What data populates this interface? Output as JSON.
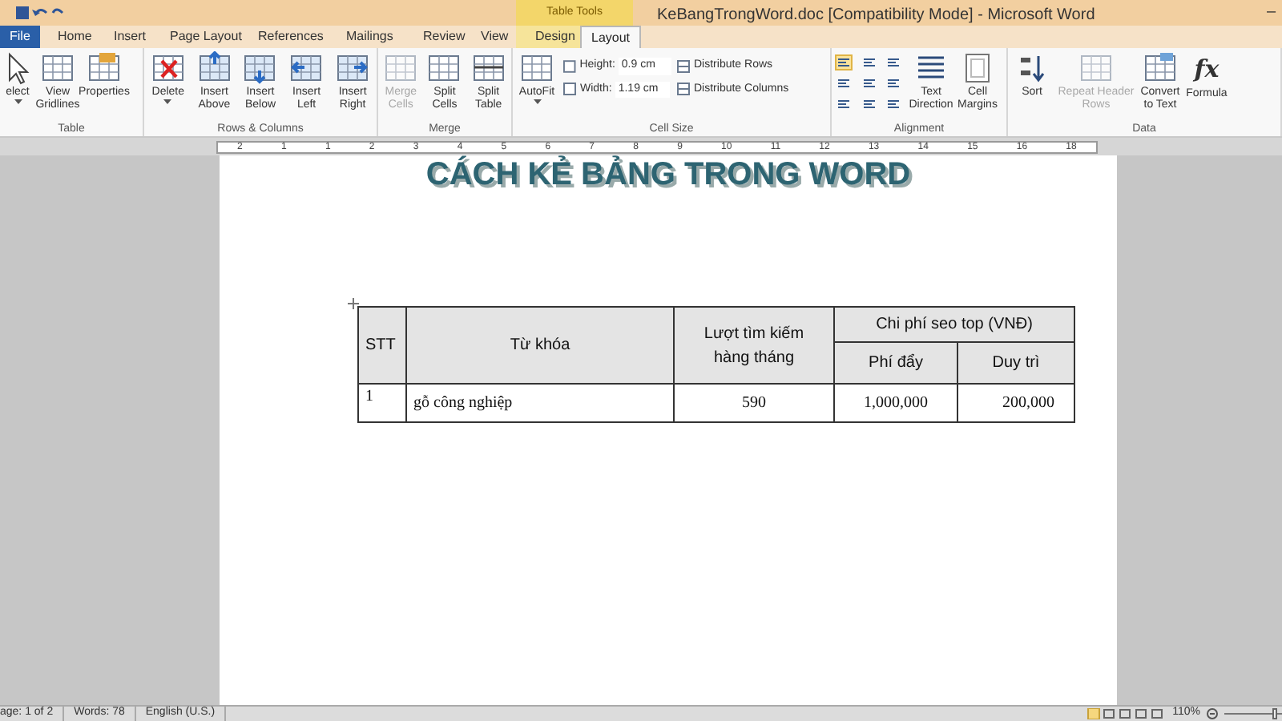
{
  "title_bar": {
    "title": "KeBangTrongWord.doc [Compatibility Mode] - Microsoft Word",
    "contextual_label": "Table Tools",
    "minimize": "–"
  },
  "tabs": [
    {
      "label": "File",
      "kind": "file",
      "selected": false
    },
    {
      "label": "Home",
      "kind": "normal",
      "selected": false
    },
    {
      "label": "Insert",
      "kind": "normal",
      "selected": false
    },
    {
      "label": "Page Layout",
      "kind": "normal",
      "selected": false
    },
    {
      "label": "References",
      "kind": "normal",
      "selected": false
    },
    {
      "label": "Mailings",
      "kind": "normal",
      "selected": false
    },
    {
      "label": "Review",
      "kind": "normal",
      "selected": false
    },
    {
      "label": "View",
      "kind": "normal",
      "selected": false
    },
    {
      "label": "Design",
      "kind": "contextual",
      "selected": false
    },
    {
      "label": "Layout",
      "kind": "contextual",
      "selected": true
    }
  ],
  "ribbon": {
    "groups": [
      {
        "label": "Table",
        "items": [
          {
            "kind": "cursor",
            "label": "elect",
            "disabled": false,
            "dropdown": true
          },
          {
            "kind": "grid",
            "label": "View Gridlines",
            "disabled": false,
            "dropdown": false
          },
          {
            "kind": "properties",
            "label": "Properties",
            "disabled": false,
            "dropdown": false
          }
        ]
      },
      {
        "label": "Rows & Columns",
        "items": [
          {
            "kind": "delete",
            "label": "Delete",
            "disabled": false,
            "dropdown": true
          },
          {
            "kind": "insert_above",
            "label": "Insert Above",
            "disabled": false,
            "dropdown": false
          },
          {
            "kind": "insert_below",
            "label": "Insert Below",
            "disabled": false,
            "dropdown": false
          },
          {
            "kind": "insert_left",
            "label": "Insert Left",
            "disabled": false,
            "dropdown": false
          },
          {
            "kind": "insert_right",
            "label": "Insert Right",
            "disabled": false,
            "dropdown": false
          }
        ]
      },
      {
        "label": "Merge",
        "items": [
          {
            "kind": "merge",
            "label": "Merge Cells",
            "disabled": true,
            "dropdown": false
          },
          {
            "kind": "split",
            "label": "Split Cells",
            "disabled": false,
            "dropdown": false
          },
          {
            "kind": "split_table",
            "label": "Split Table",
            "disabled": false,
            "dropdown": false
          }
        ]
      },
      {
        "label": "Cell Size",
        "items": [
          {
            "kind": "autofit",
            "label": "AutoFit",
            "disabled": false,
            "dropdown": true
          },
          {
            "kind": "spinners",
            "fields": [
              {
                "label": "Height:",
                "value": "0.9 cm"
              },
              {
                "label": "Width:",
                "value": "1.19 cm"
              }
            ]
          },
          {
            "kind": "small_buttons",
            "buttons": [
              "Distribute Rows",
              "Distribute Columns"
            ]
          }
        ]
      },
      {
        "label": "Alignment",
        "items": [
          {
            "kind": "align_grid",
            "cells": [
              {
                "selected": true
              },
              {
                "selected": false
              },
              {
                "selected": false
              },
              {
                "selected": false
              },
              {
                "selected": false
              },
              {
                "selected": false
              },
              {
                "selected": false
              },
              {
                "selected": false
              },
              {
                "selected": false
              }
            ]
          },
          {
            "kind": "text_direction",
            "label": "Text Direction",
            "disabled": false,
            "dropdown": false
          },
          {
            "kind": "margins",
            "label": "Cell Margins",
            "disabled": false,
            "dropdown": false
          }
        ]
      },
      {
        "label": "Data",
        "items": [
          {
            "kind": "sort",
            "label": "Sort",
            "disabled": false,
            "dropdown": false
          },
          {
            "kind": "repeat",
            "label": "Repeat Header Rows",
            "disabled": true,
            "dropdown": false
          },
          {
            "kind": "convert",
            "label": "Convert to Text",
            "disabled": false,
            "dropdown": false
          },
          {
            "kind": "formula",
            "label": "Formula",
            "glyph": "fx",
            "disabled": false,
            "dropdown": false
          }
        ]
      }
    ]
  },
  "ruler": {
    "labels": [
      "2",
      "1",
      "1",
      "2",
      "3",
      "4",
      "5",
      "6",
      "7",
      "8",
      "9",
      "10",
      "11",
      "12",
      "13",
      "14",
      "15",
      "16",
      "18"
    ]
  },
  "document": {
    "heading": "CÁCH KẺ BẢNG TRONG WORD",
    "table": {
      "columns": [
        "STT",
        "Từ khóa",
        "Lượt tìm kiếm hàng tháng"
      ],
      "group_header": "Chi phí seo top (VNĐ)",
      "sub_columns": [
        "Phí đẩy",
        "Duy trì"
      ],
      "rows": [
        [
          "1",
          "gỗ công nghiệp",
          "590",
          "1,000,000",
          "200,000"
        ]
      ]
    }
  },
  "status_bar": {
    "page": "age: 1 of 2",
    "words": "Words: 78",
    "language": "English (U.S.)",
    "zoom": "110%",
    "zoom_slider": {
      "level": 0.9
    }
  }
}
